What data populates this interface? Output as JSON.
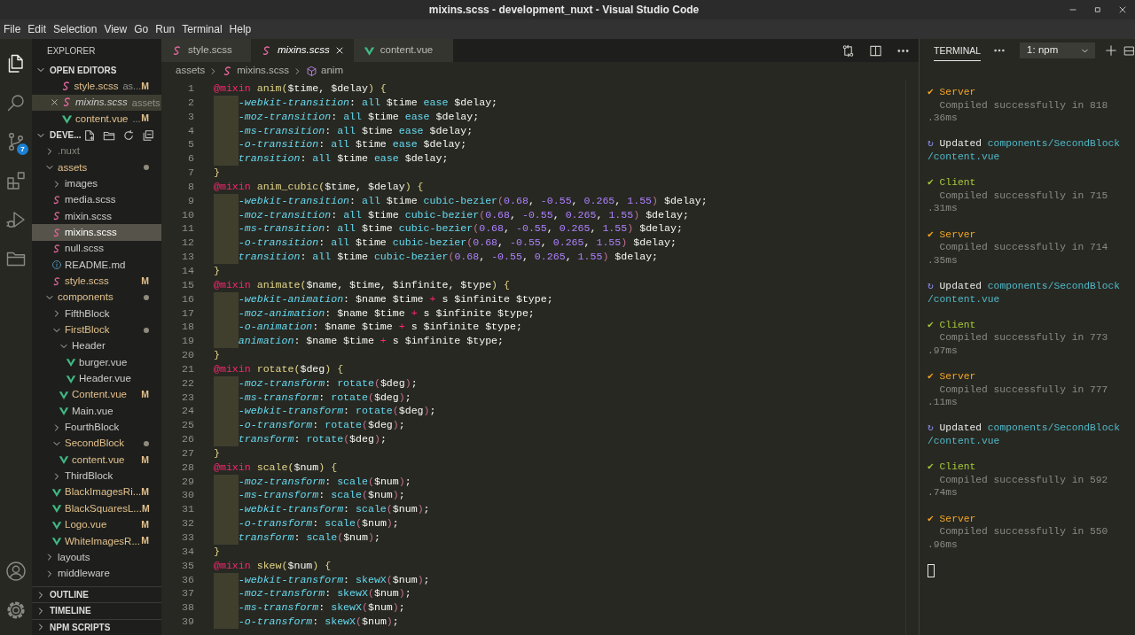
{
  "window": {
    "title": "mixins.scss - development_nuxt - Visual Studio Code"
  },
  "menu": [
    "File",
    "Edit",
    "Selection",
    "View",
    "Go",
    "Run",
    "Terminal",
    "Help"
  ],
  "activity_bar": {
    "items": [
      {
        "selected": true
      },
      {
        "selected": false
      },
      {
        "selected": false,
        "badge": "7"
      },
      {
        "selected": false
      },
      {
        "selected": false
      },
      {
        "selected": false
      }
    ]
  },
  "sidebar": {
    "title": "EXPLORER",
    "open_editors": {
      "label": "OPEN EDITORS",
      "expanded": true,
      "items": [
        {
          "name": "style.scss",
          "desc": "as...",
          "kind": "scss",
          "modified": true,
          "badge": "M",
          "selected": false,
          "preview": false
        },
        {
          "name": "mixins.scss",
          "desc": "assets",
          "kind": "scss",
          "modified": false,
          "selected": true,
          "preview": true
        },
        {
          "name": "content.vue",
          "desc": "...",
          "kind": "vue",
          "modified": true,
          "badge": "M",
          "selected": false,
          "preview": false
        }
      ]
    },
    "project": {
      "label": "DEVE...",
      "expanded": true,
      "tree": [
        {
          "name": ".nuxt",
          "kind": "folder",
          "expanded": false,
          "modified": false,
          "ignored": true,
          "selected": false
        },
        {
          "name": "assets",
          "kind": "folder",
          "expanded": true,
          "modified": true,
          "ignored": false,
          "selected": false,
          "children": [
            {
              "name": "images",
              "kind": "folder",
              "expanded": false,
              "modified": false,
              "ignored": false,
              "selected": false
            },
            {
              "name": "media.scss",
              "kind": "scss",
              "modified": false,
              "ignored": false,
              "selected": false
            },
            {
              "name": "mixin.scss",
              "kind": "scss",
              "modified": false,
              "ignored": false,
              "selected": false
            },
            {
              "name": "mixins.scss",
              "kind": "scss",
              "modified": false,
              "ignored": false,
              "selected": true
            },
            {
              "name": "null.scss",
              "kind": "scss",
              "modified": false,
              "ignored": false,
              "selected": false
            },
            {
              "name": "README.md",
              "kind": "md",
              "modified": false,
              "ignored": false,
              "selected": false
            },
            {
              "name": "style.scss",
              "kind": "scss",
              "modified": true,
              "ignored": false,
              "badge": "M",
              "selected": false
            }
          ]
        },
        {
          "name": "components",
          "kind": "folder",
          "expanded": true,
          "modified": true,
          "ignored": false,
          "selected": false,
          "children": [
            {
              "name": "FifthBlock",
              "kind": "folder",
              "expanded": false,
              "modified": false,
              "ignored": false,
              "selected": false
            },
            {
              "name": "FirstBlock",
              "kind": "folder",
              "expanded": true,
              "modified": true,
              "ignored": false,
              "selected": false,
              "children": [
                {
                  "name": "Header",
                  "kind": "folder",
                  "expanded": true,
                  "modified": false,
                  "ignored": false,
                  "selected": false,
                  "children": [
                    {
                      "name": "burger.vue",
                      "kind": "vue",
                      "modified": false,
                      "ignored": false,
                      "selected": false
                    },
                    {
                      "name": "Header.vue",
                      "kind": "vue",
                      "modified": false,
                      "ignored": false,
                      "selected": false
                    }
                  ]
                },
                {
                  "name": "Content.vue",
                  "kind": "vue",
                  "modified": true,
                  "ignored": false,
                  "badge": "M",
                  "selected": false
                },
                {
                  "name": "Main.vue",
                  "kind": "vue",
                  "modified": false,
                  "ignored": false,
                  "selected": false
                }
              ]
            },
            {
              "name": "FourthBlock",
              "kind": "folder",
              "expanded": false,
              "modified": false,
              "ignored": false,
              "selected": false
            },
            {
              "name": "SecondBlock",
              "kind": "folder",
              "expanded": true,
              "modified": true,
              "ignored": false,
              "selected": false,
              "children": [
                {
                  "name": "content.vue",
                  "kind": "vue",
                  "modified": true,
                  "ignored": false,
                  "badge": "M",
                  "selected": false
                }
              ]
            },
            {
              "name": "ThirdBlock",
              "kind": "folder",
              "expanded": false,
              "modified": false,
              "ignored": false,
              "selected": false
            },
            {
              "name": "BlackImagesRi...",
              "kind": "vue",
              "modified": true,
              "ignored": false,
              "badge": "M",
              "selected": false
            },
            {
              "name": "BlackSquaresL...",
              "kind": "vue",
              "modified": true,
              "ignored": false,
              "badge": "M",
              "selected": false
            },
            {
              "name": "Logo.vue",
              "kind": "vue",
              "modified": true,
              "ignored": false,
              "badge": "M",
              "selected": false
            },
            {
              "name": "WhiteImagesR...",
              "kind": "vue",
              "modified": true,
              "ignored": false,
              "badge": "M",
              "selected": false
            }
          ]
        },
        {
          "name": "layouts",
          "kind": "folder",
          "expanded": false,
          "modified": false,
          "ignored": false,
          "selected": false
        },
        {
          "name": "middleware",
          "kind": "folder",
          "expanded": false,
          "modified": false,
          "ignored": false,
          "selected": false
        }
      ]
    },
    "sections": [
      {
        "label": "OUTLINE",
        "expanded": false
      },
      {
        "label": "TIMELINE",
        "expanded": false
      },
      {
        "label": "NPM SCRIPTS",
        "expanded": false
      }
    ]
  },
  "editor": {
    "tabs": [
      {
        "label": "style.scss",
        "kind": "scss",
        "selected": false,
        "preview": false
      },
      {
        "label": "mixins.scss",
        "kind": "scss",
        "selected": true,
        "preview": true
      },
      {
        "label": "content.vue",
        "kind": "vue",
        "selected": false,
        "preview": false
      }
    ],
    "breadcrumb": [
      {
        "label": "assets",
        "kind": "folder"
      },
      {
        "label": "mixins.scss",
        "kind": "scss"
      },
      {
        "label": "anim",
        "kind": "symbol"
      }
    ],
    "lines": [
      {
        "n": "1",
        "indented": false,
        "tokens": [
          {
            "text": "@mixin",
            "kind": "keyword"
          },
          {
            "text": " anim(",
            "kind": "name"
          },
          {
            "text": "$time, $delay",
            "kind": "plain"
          },
          {
            "text": ") {",
            "kind": "name"
          }
        ]
      },
      {
        "n": "2",
        "indented": true,
        "tokens": [
          {
            "text": "-webkit-transition",
            "kind": "property"
          },
          {
            "text": ": ",
            "kind": "plain"
          },
          {
            "text": "all",
            "kind": "value"
          },
          {
            "text": " $time ",
            "kind": "plain"
          },
          {
            "text": "ease",
            "kind": "value"
          },
          {
            "text": " $delay;",
            "kind": "plain"
          }
        ]
      },
      {
        "n": "3",
        "indented": true,
        "tokens": [
          {
            "text": "-moz-transition",
            "kind": "property"
          },
          {
            "text": ": ",
            "kind": "plain"
          },
          {
            "text": "all",
            "kind": "value"
          },
          {
            "text": " $time ",
            "kind": "plain"
          },
          {
            "text": "ease",
            "kind": "value"
          },
          {
            "text": " $delay;",
            "kind": "plain"
          }
        ]
      },
      {
        "n": "4",
        "indented": true,
        "tokens": [
          {
            "text": "-ms-transition",
            "kind": "property"
          },
          {
            "text": ": ",
            "kind": "plain"
          },
          {
            "text": "all",
            "kind": "value"
          },
          {
            "text": " $time ",
            "kind": "plain"
          },
          {
            "text": "ease",
            "kind": "value"
          },
          {
            "text": " $delay;",
            "kind": "plain"
          }
        ]
      },
      {
        "n": "5",
        "indented": true,
        "tokens": [
          {
            "text": "-o-transition",
            "kind": "property"
          },
          {
            "text": ": ",
            "kind": "plain"
          },
          {
            "text": "all",
            "kind": "value"
          },
          {
            "text": " $time ",
            "kind": "plain"
          },
          {
            "text": "ease",
            "kind": "value"
          },
          {
            "text": " $delay;",
            "kind": "plain"
          }
        ]
      },
      {
        "n": "6",
        "indented": true,
        "tokens": [
          {
            "text": "transition",
            "kind": "property"
          },
          {
            "text": ": ",
            "kind": "plain"
          },
          {
            "text": "all",
            "kind": "value"
          },
          {
            "text": " $time ",
            "kind": "plain"
          },
          {
            "text": "ease",
            "kind": "value"
          },
          {
            "text": " $delay;",
            "kind": "plain"
          }
        ]
      },
      {
        "n": "7",
        "indented": false,
        "tokens": [
          {
            "text": "}",
            "kind": "name"
          }
        ]
      },
      {
        "n": "8",
        "indented": false,
        "tokens": [
          {
            "text": "@mixin",
            "kind": "keyword"
          },
          {
            "text": " anim_cubic(",
            "kind": "name"
          },
          {
            "text": "$time, $delay",
            "kind": "plain"
          },
          {
            "text": ") {",
            "kind": "name"
          }
        ]
      },
      {
        "n": "9",
        "indented": true,
        "tokens": [
          {
            "text": "-webkit-transition",
            "kind": "property"
          },
          {
            "text": ": ",
            "kind": "plain"
          },
          {
            "text": "all",
            "kind": "value"
          },
          {
            "text": " $time ",
            "kind": "plain"
          },
          {
            "text": "cubic-bezier",
            "kind": "value"
          },
          {
            "text": "(",
            "kind": "paren"
          },
          {
            "text": "0.68",
            "kind": "number"
          },
          {
            "text": ", ",
            "kind": "plain"
          },
          {
            "text": "-0.55",
            "kind": "number"
          },
          {
            "text": ", ",
            "kind": "plain"
          },
          {
            "text": "0.265",
            "kind": "number"
          },
          {
            "text": ", ",
            "kind": "plain"
          },
          {
            "text": "1.55",
            "kind": "number"
          },
          {
            "text": ")",
            "kind": "paren"
          },
          {
            "text": " $delay;",
            "kind": "plain"
          }
        ]
      },
      {
        "n": "10",
        "indented": true,
        "tokens": [
          {
            "text": "-moz-transition",
            "kind": "property"
          },
          {
            "text": ": ",
            "kind": "plain"
          },
          {
            "text": "all",
            "kind": "value"
          },
          {
            "text": " $time ",
            "kind": "plain"
          },
          {
            "text": "cubic-bezier",
            "kind": "value"
          },
          {
            "text": "(",
            "kind": "paren"
          },
          {
            "text": "0.68",
            "kind": "number"
          },
          {
            "text": ", ",
            "kind": "plain"
          },
          {
            "text": "-0.55",
            "kind": "number"
          },
          {
            "text": ", ",
            "kind": "plain"
          },
          {
            "text": "0.265",
            "kind": "number"
          },
          {
            "text": ", ",
            "kind": "plain"
          },
          {
            "text": "1.55",
            "kind": "number"
          },
          {
            "text": ")",
            "kind": "paren"
          },
          {
            "text": " $delay;",
            "kind": "plain"
          }
        ]
      },
      {
        "n": "11",
        "indented": true,
        "tokens": [
          {
            "text": "-ms-transition",
            "kind": "property"
          },
          {
            "text": ": ",
            "kind": "plain"
          },
          {
            "text": "all",
            "kind": "value"
          },
          {
            "text": " $time ",
            "kind": "plain"
          },
          {
            "text": "cubic-bezier",
            "kind": "value"
          },
          {
            "text": "(",
            "kind": "paren"
          },
          {
            "text": "0.68",
            "kind": "number"
          },
          {
            "text": ", ",
            "kind": "plain"
          },
          {
            "text": "-0.55",
            "kind": "number"
          },
          {
            "text": ", ",
            "kind": "plain"
          },
          {
            "text": "0.265",
            "kind": "number"
          },
          {
            "text": ", ",
            "kind": "plain"
          },
          {
            "text": "1.55",
            "kind": "number"
          },
          {
            "text": ")",
            "kind": "paren"
          },
          {
            "text": " $delay;",
            "kind": "plain"
          }
        ]
      },
      {
        "n": "12",
        "indented": true,
        "tokens": [
          {
            "text": "-o-transition",
            "kind": "property"
          },
          {
            "text": ": ",
            "kind": "plain"
          },
          {
            "text": "all",
            "kind": "value"
          },
          {
            "text": " $time ",
            "kind": "plain"
          },
          {
            "text": "cubic-bezier",
            "kind": "value"
          },
          {
            "text": "(",
            "kind": "paren"
          },
          {
            "text": "0.68",
            "kind": "number"
          },
          {
            "text": ", ",
            "kind": "plain"
          },
          {
            "text": "-0.55",
            "kind": "number"
          },
          {
            "text": ", ",
            "kind": "plain"
          },
          {
            "text": "0.265",
            "kind": "number"
          },
          {
            "text": ", ",
            "kind": "plain"
          },
          {
            "text": "1.55",
            "kind": "number"
          },
          {
            "text": ")",
            "kind": "paren"
          },
          {
            "text": " $delay;",
            "kind": "plain"
          }
        ]
      },
      {
        "n": "13",
        "indented": true,
        "tokens": [
          {
            "text": "transition",
            "kind": "property"
          },
          {
            "text": ": ",
            "kind": "plain"
          },
          {
            "text": "all",
            "kind": "value"
          },
          {
            "text": " $time ",
            "kind": "plain"
          },
          {
            "text": "cubic-bezier",
            "kind": "value"
          },
          {
            "text": "(",
            "kind": "paren"
          },
          {
            "text": "0.68",
            "kind": "number"
          },
          {
            "text": ", ",
            "kind": "plain"
          },
          {
            "text": "-0.55",
            "kind": "number"
          },
          {
            "text": ", ",
            "kind": "plain"
          },
          {
            "text": "0.265",
            "kind": "number"
          },
          {
            "text": ", ",
            "kind": "plain"
          },
          {
            "text": "1.55",
            "kind": "number"
          },
          {
            "text": ")",
            "kind": "paren"
          },
          {
            "text": " $delay;",
            "kind": "plain"
          }
        ]
      },
      {
        "n": "14",
        "indented": false,
        "tokens": [
          {
            "text": "}",
            "kind": "name"
          }
        ]
      },
      {
        "n": "15",
        "indented": false,
        "tokens": [
          {
            "text": "@mixin",
            "kind": "keyword"
          },
          {
            "text": " animate(",
            "kind": "name"
          },
          {
            "text": "$name, $time, $infinite, $type",
            "kind": "plain"
          },
          {
            "text": ") {",
            "kind": "name"
          }
        ]
      },
      {
        "n": "16",
        "indented": true,
        "tokens": [
          {
            "text": "-webkit-animation",
            "kind": "property"
          },
          {
            "text": ": $name $time ",
            "kind": "plain"
          },
          {
            "text": "+",
            "kind": "operator"
          },
          {
            "text": " s $infinite $type;",
            "kind": "plain"
          }
        ]
      },
      {
        "n": "17",
        "indented": true,
        "tokens": [
          {
            "text": "-moz-animation",
            "kind": "property"
          },
          {
            "text": ": $name $time ",
            "kind": "plain"
          },
          {
            "text": "+",
            "kind": "operator"
          },
          {
            "text": " s $infinite $type;",
            "kind": "plain"
          }
        ]
      },
      {
        "n": "18",
        "indented": true,
        "tokens": [
          {
            "text": "-o-animation",
            "kind": "property"
          },
          {
            "text": ": $name $time ",
            "kind": "plain"
          },
          {
            "text": "+",
            "kind": "operator"
          },
          {
            "text": " s $infinite $type;",
            "kind": "plain"
          }
        ]
      },
      {
        "n": "19",
        "indented": true,
        "tokens": [
          {
            "text": "animation",
            "kind": "property"
          },
          {
            "text": ": $name $time ",
            "kind": "plain"
          },
          {
            "text": "+",
            "kind": "operator"
          },
          {
            "text": " s $infinite $type;",
            "kind": "plain"
          }
        ]
      },
      {
        "n": "20",
        "indented": false,
        "tokens": [
          {
            "text": "}",
            "kind": "name"
          }
        ]
      },
      {
        "n": "21",
        "indented": false,
        "tokens": [
          {
            "text": "@mixin",
            "kind": "keyword"
          },
          {
            "text": " rotate(",
            "kind": "name"
          },
          {
            "text": "$deg",
            "kind": "plain"
          },
          {
            "text": ") {",
            "kind": "name"
          }
        ]
      },
      {
        "n": "22",
        "indented": true,
        "tokens": [
          {
            "text": "-moz-transform",
            "kind": "property"
          },
          {
            "text": ": ",
            "kind": "plain"
          },
          {
            "text": "rotate",
            "kind": "value"
          },
          {
            "text": "(",
            "kind": "paren"
          },
          {
            "text": "$deg",
            "kind": "plain"
          },
          {
            "text": ")",
            "kind": "paren"
          },
          {
            "text": ";",
            "kind": "plain"
          }
        ]
      },
      {
        "n": "23",
        "indented": true,
        "tokens": [
          {
            "text": "-ms-transform",
            "kind": "property"
          },
          {
            "text": ": ",
            "kind": "plain"
          },
          {
            "text": "rotate",
            "kind": "value"
          },
          {
            "text": "(",
            "kind": "paren"
          },
          {
            "text": "$deg",
            "kind": "plain"
          },
          {
            "text": ")",
            "kind": "paren"
          },
          {
            "text": ";",
            "kind": "plain"
          }
        ]
      },
      {
        "n": "24",
        "indented": true,
        "tokens": [
          {
            "text": "-webkit-transform",
            "kind": "property"
          },
          {
            "text": ": ",
            "kind": "plain"
          },
          {
            "text": "rotate",
            "kind": "value"
          },
          {
            "text": "(",
            "kind": "paren"
          },
          {
            "text": "$deg",
            "kind": "plain"
          },
          {
            "text": ")",
            "kind": "paren"
          },
          {
            "text": ";",
            "kind": "plain"
          }
        ]
      },
      {
        "n": "25",
        "indented": true,
        "tokens": [
          {
            "text": "-o-transform",
            "kind": "property"
          },
          {
            "text": ": ",
            "kind": "plain"
          },
          {
            "text": "rotate",
            "kind": "value"
          },
          {
            "text": "(",
            "kind": "paren"
          },
          {
            "text": "$deg",
            "kind": "plain"
          },
          {
            "text": ")",
            "kind": "paren"
          },
          {
            "text": ";",
            "kind": "plain"
          }
        ]
      },
      {
        "n": "26",
        "indented": true,
        "tokens": [
          {
            "text": "transform",
            "kind": "property"
          },
          {
            "text": ": ",
            "kind": "plain"
          },
          {
            "text": "rotate",
            "kind": "value"
          },
          {
            "text": "(",
            "kind": "paren"
          },
          {
            "text": "$deg",
            "kind": "plain"
          },
          {
            "text": ")",
            "kind": "paren"
          },
          {
            "text": ";",
            "kind": "plain"
          }
        ]
      },
      {
        "n": "27",
        "indented": false,
        "tokens": [
          {
            "text": "}",
            "kind": "name"
          }
        ]
      },
      {
        "n": "28",
        "indented": false,
        "tokens": [
          {
            "text": "@mixin",
            "kind": "keyword"
          },
          {
            "text": " scale(",
            "kind": "name"
          },
          {
            "text": "$num",
            "kind": "plain"
          },
          {
            "text": ") {",
            "kind": "name"
          }
        ]
      },
      {
        "n": "29",
        "indented": true,
        "tokens": [
          {
            "text": "-moz-transform",
            "kind": "property"
          },
          {
            "text": ": ",
            "kind": "plain"
          },
          {
            "text": "scale",
            "kind": "value"
          },
          {
            "text": "(",
            "kind": "paren"
          },
          {
            "text": "$num",
            "kind": "plain"
          },
          {
            "text": ")",
            "kind": "paren"
          },
          {
            "text": ";",
            "kind": "plain"
          }
        ]
      },
      {
        "n": "30",
        "indented": true,
        "tokens": [
          {
            "text": "-ms-transform",
            "kind": "property"
          },
          {
            "text": ": ",
            "kind": "plain"
          },
          {
            "text": "scale",
            "kind": "value"
          },
          {
            "text": "(",
            "kind": "paren"
          },
          {
            "text": "$num",
            "kind": "plain"
          },
          {
            "text": ")",
            "kind": "paren"
          },
          {
            "text": ";",
            "kind": "plain"
          }
        ]
      },
      {
        "n": "31",
        "indented": true,
        "tokens": [
          {
            "text": "-webkit-transform",
            "kind": "property"
          },
          {
            "text": ": ",
            "kind": "plain"
          },
          {
            "text": "scale",
            "kind": "value"
          },
          {
            "text": "(",
            "kind": "paren"
          },
          {
            "text": "$num",
            "kind": "plain"
          },
          {
            "text": ")",
            "kind": "paren"
          },
          {
            "text": ";",
            "kind": "plain"
          }
        ]
      },
      {
        "n": "32",
        "indented": true,
        "tokens": [
          {
            "text": "-o-transform",
            "kind": "property"
          },
          {
            "text": ": ",
            "kind": "plain"
          },
          {
            "text": "scale",
            "kind": "value"
          },
          {
            "text": "(",
            "kind": "paren"
          },
          {
            "text": "$num",
            "kind": "plain"
          },
          {
            "text": ")",
            "kind": "paren"
          },
          {
            "text": ";",
            "kind": "plain"
          }
        ]
      },
      {
        "n": "33",
        "indented": true,
        "tokens": [
          {
            "text": "transform",
            "kind": "property"
          },
          {
            "text": ": ",
            "kind": "plain"
          },
          {
            "text": "scale",
            "kind": "value"
          },
          {
            "text": "(",
            "kind": "paren"
          },
          {
            "text": "$num",
            "kind": "plain"
          },
          {
            "text": ")",
            "kind": "paren"
          },
          {
            "text": ";",
            "kind": "plain"
          }
        ]
      },
      {
        "n": "34",
        "indented": false,
        "tokens": [
          {
            "text": "}",
            "kind": "name"
          }
        ]
      },
      {
        "n": "35",
        "indented": false,
        "tokens": [
          {
            "text": "@mixin",
            "kind": "keyword"
          },
          {
            "text": " skew(",
            "kind": "name"
          },
          {
            "text": "$num",
            "kind": "plain"
          },
          {
            "text": ") {",
            "kind": "name"
          }
        ]
      },
      {
        "n": "36",
        "indented": true,
        "tokens": [
          {
            "text": "-webkit-transform",
            "kind": "property"
          },
          {
            "text": ": ",
            "kind": "plain"
          },
          {
            "text": "skewX",
            "kind": "value"
          },
          {
            "text": "(",
            "kind": "paren"
          },
          {
            "text": "$num",
            "kind": "plain"
          },
          {
            "text": ")",
            "kind": "paren"
          },
          {
            "text": ";",
            "kind": "plain"
          }
        ]
      },
      {
        "n": "37",
        "indented": true,
        "tokens": [
          {
            "text": "-moz-transform",
            "kind": "property"
          },
          {
            "text": ": ",
            "kind": "plain"
          },
          {
            "text": "skewX",
            "kind": "value"
          },
          {
            "text": "(",
            "kind": "paren"
          },
          {
            "text": "$num",
            "kind": "plain"
          },
          {
            "text": ")",
            "kind": "paren"
          },
          {
            "text": ";",
            "kind": "plain"
          }
        ]
      },
      {
        "n": "38",
        "indented": true,
        "tokens": [
          {
            "text": "-ms-transform",
            "kind": "property"
          },
          {
            "text": ": ",
            "kind": "plain"
          },
          {
            "text": "skewX",
            "kind": "value"
          },
          {
            "text": "(",
            "kind": "paren"
          },
          {
            "text": "$num",
            "kind": "plain"
          },
          {
            "text": ")",
            "kind": "paren"
          },
          {
            "text": ";",
            "kind": "plain"
          }
        ]
      },
      {
        "n": "39",
        "indented": true,
        "tokens": [
          {
            "text": "-o-transform",
            "kind": "property"
          },
          {
            "text": ": ",
            "kind": "plain"
          },
          {
            "text": "skewX",
            "kind": "value"
          },
          {
            "text": "(",
            "kind": "paren"
          },
          {
            "text": "$num",
            "kind": "plain"
          },
          {
            "text": ")",
            "kind": "paren"
          },
          {
            "text": ";",
            "kind": "plain"
          }
        ]
      }
    ]
  },
  "terminal": {
    "title": "TERMINAL",
    "selected": true,
    "instance": "1: npm",
    "entries": [
      {
        "kind": "server",
        "mark": "✔",
        "label": "Server",
        "lines": [
          "Compiled successfully in 818",
          ".36ms"
        ]
      },
      {
        "kind": "updated",
        "mark": "↻",
        "label": "Updated",
        "lines": [
          "components/SecondBlock",
          "/content.vue"
        ]
      },
      {
        "kind": "client",
        "mark": "✔",
        "label": "Client",
        "lines": [
          "Compiled successfully in 715",
          ".31ms"
        ]
      },
      {
        "kind": "server",
        "mark": "✔",
        "label": "Server",
        "lines": [
          "Compiled successfully in 714",
          ".35ms"
        ]
      },
      {
        "kind": "updated",
        "mark": "↻",
        "label": "Updated",
        "lines": [
          "components/SecondBlock",
          "/content.vue"
        ]
      },
      {
        "kind": "client",
        "mark": "✔",
        "label": "Client",
        "lines": [
          "Compiled successfully in 773",
          ".97ms"
        ]
      },
      {
        "kind": "server",
        "mark": "✔",
        "label": "Server",
        "lines": [
          "Compiled successfully in 777",
          ".11ms"
        ]
      },
      {
        "kind": "updated",
        "mark": "↻",
        "label": "Updated",
        "lines": [
          "components/SecondBlock",
          "/content.vue"
        ]
      },
      {
        "kind": "client",
        "mark": "✔",
        "label": "Client",
        "lines": [
          "Compiled successfully in 592",
          ".74ms"
        ]
      },
      {
        "kind": "server",
        "mark": "✔",
        "label": "Server",
        "lines": [
          "Compiled successfully in 550",
          ".96ms"
        ]
      }
    ]
  }
}
